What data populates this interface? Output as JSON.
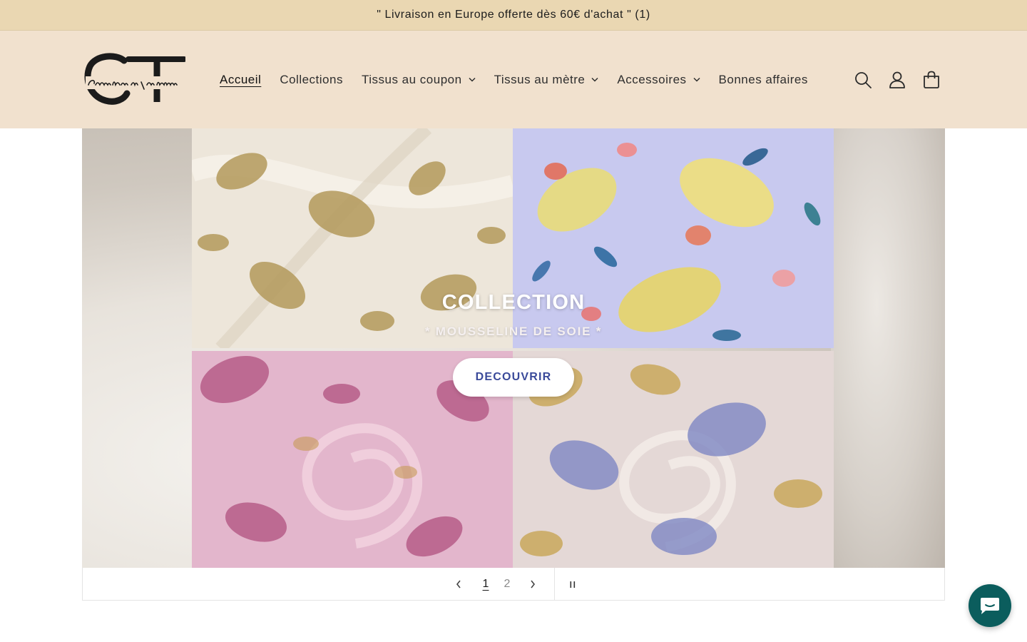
{
  "announcement": {
    "text": "\" Livraison en Europe offerte dès 60€ d'achat \" (1)"
  },
  "header": {
    "logo_text": "Comptoir du Textile",
    "logo_monogram": "CT",
    "nav": [
      {
        "label": "Accueil",
        "active": true,
        "dropdown": false
      },
      {
        "label": "Collections",
        "active": false,
        "dropdown": false
      },
      {
        "label": "Tissus au coupon",
        "active": false,
        "dropdown": true
      },
      {
        "label": "Tissus au mètre",
        "active": false,
        "dropdown": true
      },
      {
        "label": "Accessoires",
        "active": false,
        "dropdown": true
      },
      {
        "label": "Bonnes affaires",
        "active": false,
        "dropdown": false
      }
    ],
    "icons": [
      "search-icon",
      "account-icon",
      "cart-icon"
    ]
  },
  "slideshow": {
    "heading": "COLLECTION",
    "subheading": "* MOUSSELINE DE SOIE *",
    "button_label": "DECOUVRIR",
    "current_slide": "1",
    "slides": [
      "1",
      "2"
    ],
    "pause_symbol": "II"
  },
  "colors": {
    "announcement_bg": "#ead7b2",
    "header_bg": "#f1e1ce",
    "button_text": "#3a4a9a",
    "chat_bg": "#0b5d5d"
  }
}
